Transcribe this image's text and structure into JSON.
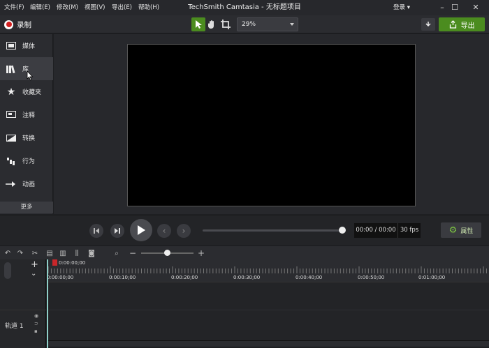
{
  "menu": [
    "文件(F)",
    "编辑(E)",
    "修改(M)",
    "视图(V)",
    "导出(E)",
    "帮助(H)"
  ],
  "app_title": "TechSmith Camtasia - 无标题项目",
  "login": "登录",
  "toolbar": {
    "record_label": "录制",
    "zoom_value": "29%",
    "export_label": "导出"
  },
  "sidebar": {
    "items": [
      {
        "label": "媒体",
        "icon": "film-icon"
      },
      {
        "label": "库",
        "icon": "library-icon"
      },
      {
        "label": "收藏夹",
        "icon": "star-icon"
      },
      {
        "label": "注释",
        "icon": "annotation-icon"
      },
      {
        "label": "转换",
        "icon": "transition-icon"
      },
      {
        "label": "行为",
        "icon": "behavior-icon"
      },
      {
        "label": "动画",
        "icon": "animation-icon"
      }
    ],
    "more_label": "更多",
    "selected_index": 1
  },
  "player": {
    "timecode": "00:00 / 00:00",
    "fps": "30 fps",
    "properties_label": "属性"
  },
  "timeline": {
    "playhead_time": "0:00:00;00",
    "ticks": [
      "0:00:00;00",
      "0:00:10;00",
      "0:00:20;00",
      "0:00:30;00",
      "0:00:40;00",
      "0:00:50;00",
      "0:01:00;00"
    ],
    "track_label": "轨道 1"
  },
  "colors": {
    "accent": "#4b8c1f",
    "record": "#d32020",
    "playhead": "#8fd0c7"
  }
}
